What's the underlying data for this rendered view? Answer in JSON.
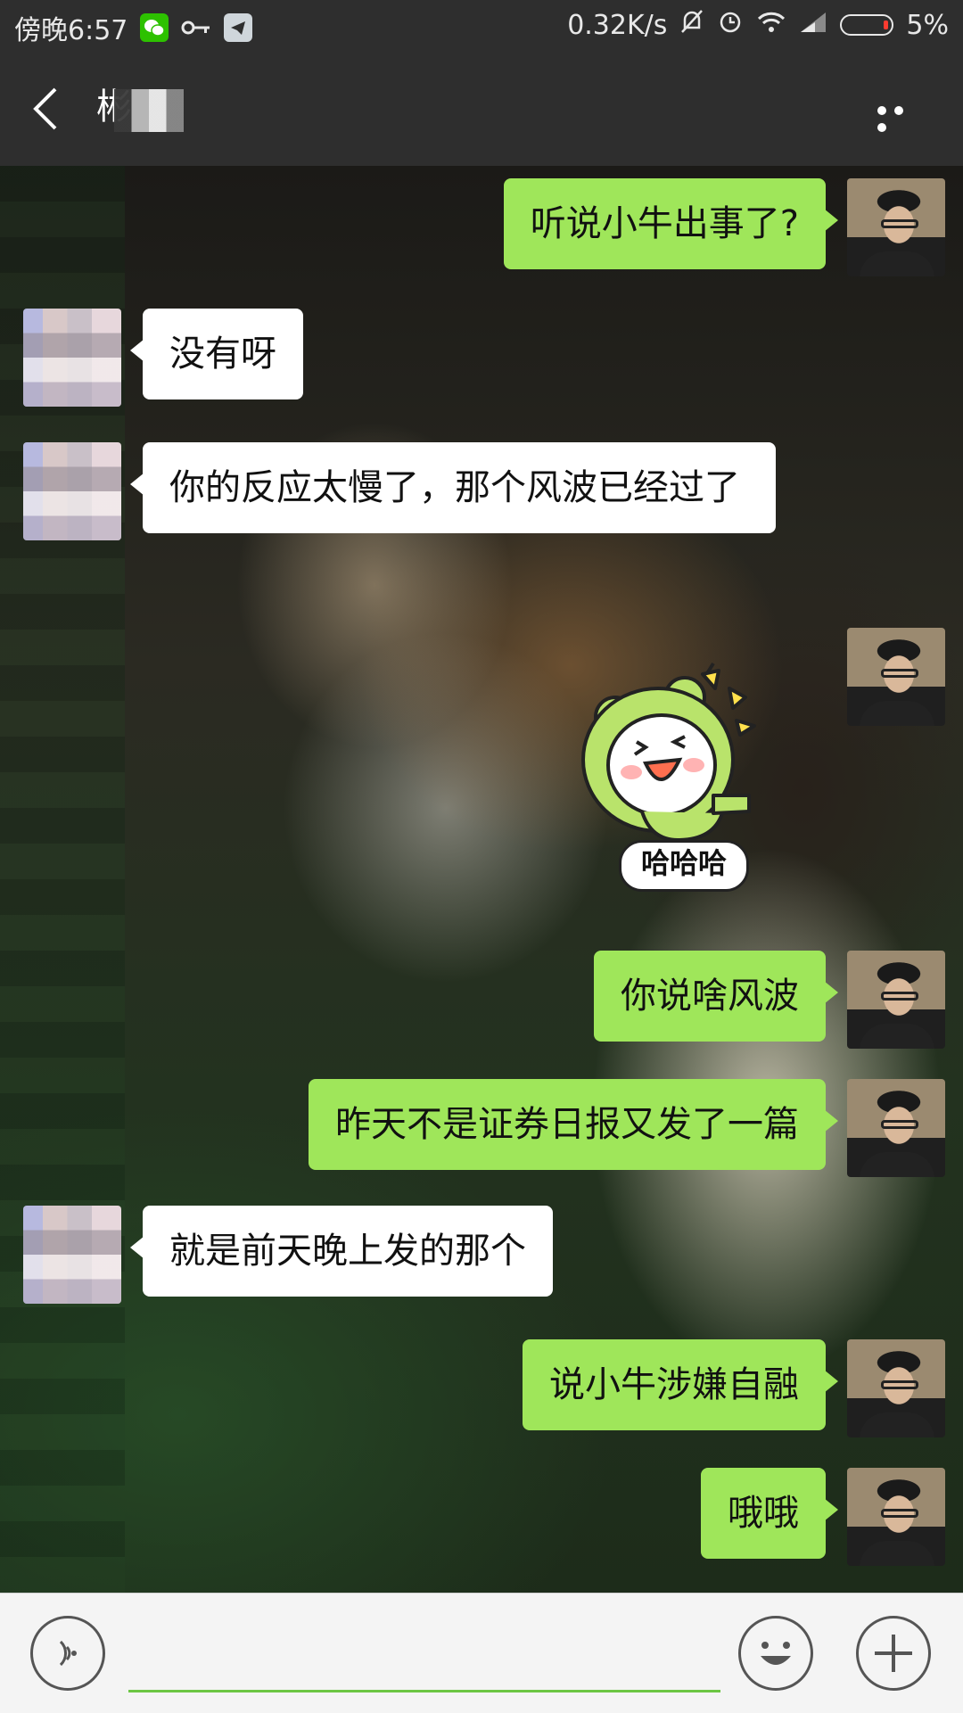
{
  "status_bar": {
    "time": "傍晚6:57",
    "net_speed": "0.32K/s",
    "battery": "5%",
    "icons": [
      "wechat-icon",
      "key-icon",
      "telegram-icon",
      "mute-bell-icon",
      "alarm-icon",
      "wifi-icon",
      "signal-icon",
      "battery-icon"
    ]
  },
  "header": {
    "contact_name": "彬"
  },
  "messages": [
    {
      "side": "right",
      "text": "听说小牛出事了?"
    },
    {
      "side": "left",
      "text": "没有呀"
    },
    {
      "side": "left",
      "text": "你的反应太慢了，那个风波已经过了"
    },
    {
      "side": "right",
      "type": "sticker",
      "caption": "哈哈哈"
    },
    {
      "side": "right",
      "text": "你说啥风波"
    },
    {
      "side": "right",
      "text": "昨天不是证券日报又发了一篇"
    },
    {
      "side": "left",
      "text": "就是前天晚上发的那个"
    },
    {
      "side": "right",
      "text": "说小牛涉嫌自融"
    },
    {
      "side": "right",
      "text": "哦哦"
    }
  ],
  "input": {
    "value": "",
    "placeholder": ""
  },
  "colors": {
    "bar_background": "#2e2e2e",
    "my_bubble": "#9fe65a",
    "their_bubble": "#ffffff",
    "input_underline": "#6cc644"
  }
}
